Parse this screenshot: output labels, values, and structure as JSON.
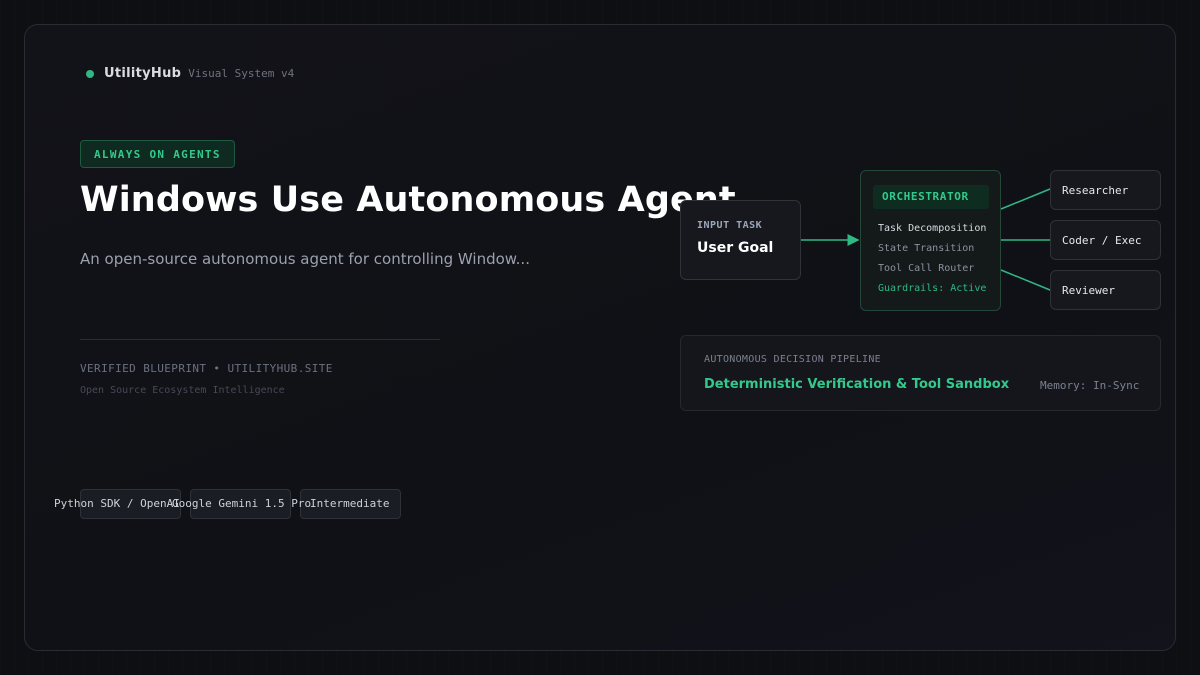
{
  "brand": {
    "name": "UtilityHub",
    "subtitle": "Visual System v4"
  },
  "badge": "ALWAYS ON AGENTS",
  "title": "Windows Use Autonomous Agent",
  "description": "An open-source autonomous agent for controlling Window...",
  "verified": "VERIFIED BLUEPRINT • UTILITYHUB.SITE",
  "ecosystem": "Open Source Ecosystem Intelligence",
  "chips": [
    "Python SDK / OpenAI",
    "Google Gemini 1.5 Pro",
    "Intermediate"
  ],
  "diagram": {
    "input": {
      "label": "INPUT TASK",
      "value": "User Goal"
    },
    "orchestrator": {
      "title": "ORCHESTRATOR",
      "items": [
        "Task Decomposition",
        "State Transition",
        "Tool Call Router",
        "Guardrails: Active"
      ]
    },
    "agents": [
      "Researcher",
      "Coder / Exec",
      "Reviewer"
    ],
    "pipeline": {
      "label": "AUTONOMOUS DECISION PIPELINE",
      "title": "Deterministic Verification & Tool Sandbox",
      "memory": "Memory: In-Sync"
    }
  },
  "colors": {
    "accent": "#34c98c",
    "background": "#0e0f13",
    "connector": "#2fb884"
  }
}
